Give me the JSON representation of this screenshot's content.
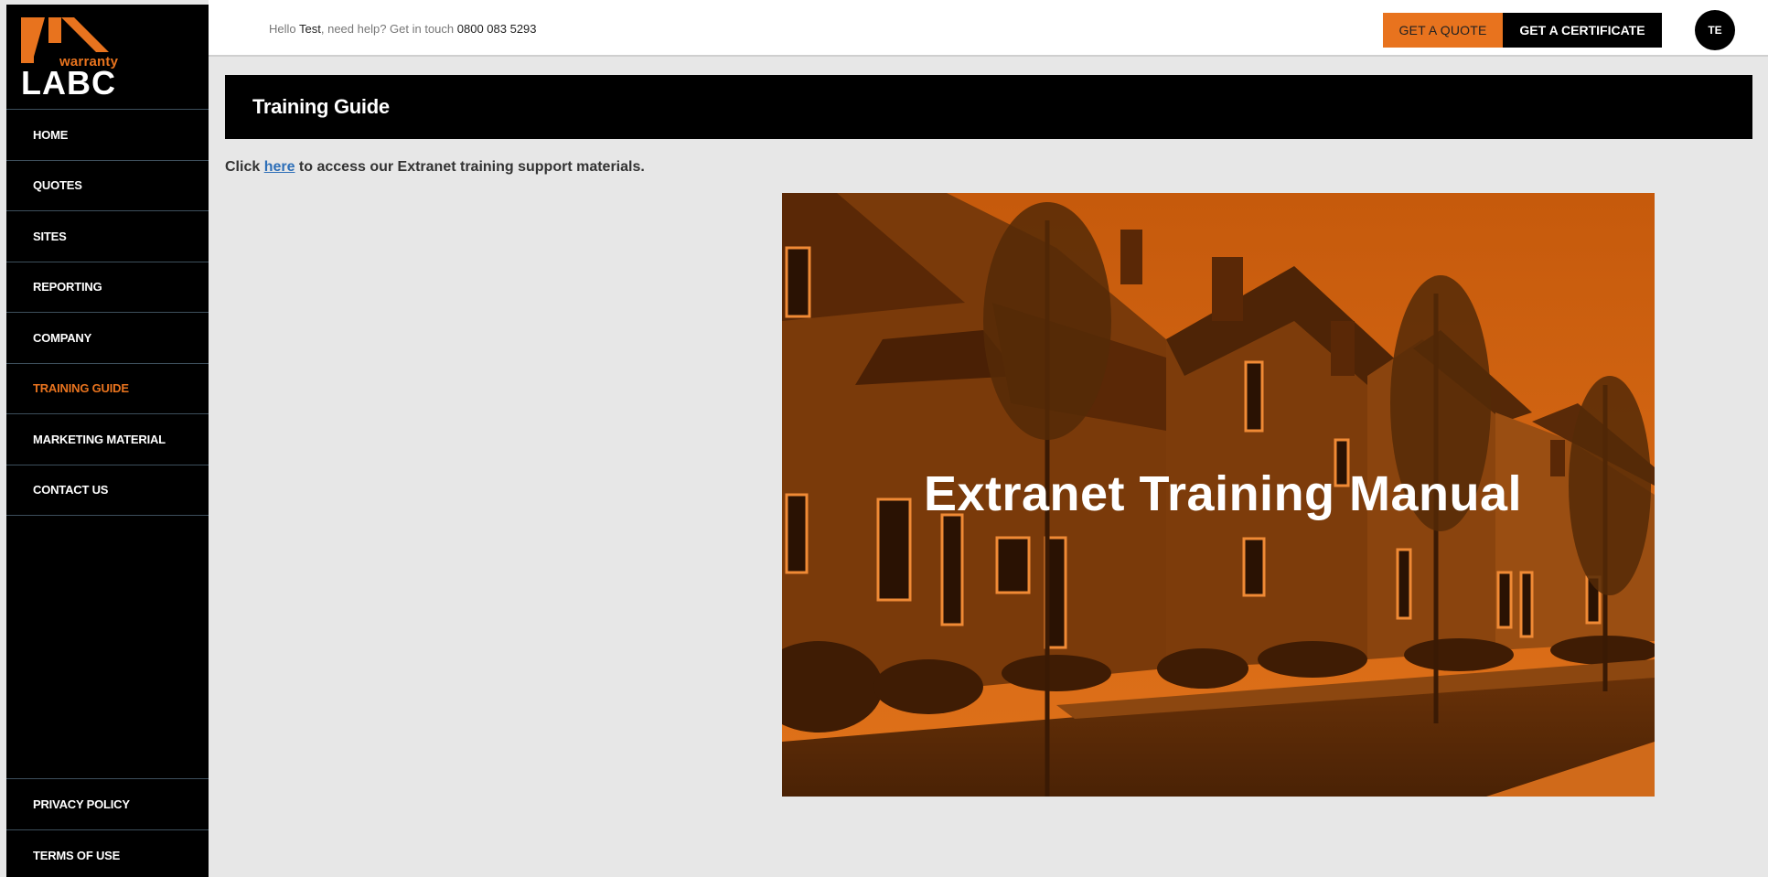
{
  "brand": {
    "logo_warranty": "warranty",
    "logo_labc": "LABC",
    "accent_color": "#e8731e"
  },
  "sidebar": {
    "items": [
      {
        "label": "HOME"
      },
      {
        "label": "QUOTES"
      },
      {
        "label": "SITES"
      },
      {
        "label": "REPORTING"
      },
      {
        "label": "COMPANY"
      },
      {
        "label": "TRAINING GUIDE",
        "active": true
      },
      {
        "label": "MARKETING MATERIAL"
      },
      {
        "label": "CONTACT US"
      }
    ],
    "footer_items": [
      {
        "label": "PRIVACY POLICY"
      },
      {
        "label": "TERMS OF USE"
      }
    ]
  },
  "header": {
    "greeting_prefix": "Hello ",
    "user_name": "Test",
    "greeting_mid": ", need help? Get in touch ",
    "phone": "0800 083 5293",
    "quote_button": "GET A QUOTE",
    "certificate_button": "GET A CERTIFICATE",
    "avatar_initials": "TE"
  },
  "main": {
    "page_title": "Training Guide",
    "intro_prefix": "Click ",
    "intro_link": "here",
    "intro_suffix": " to access our Extranet training support materials.",
    "hero_title": "Extranet Training Manual"
  }
}
